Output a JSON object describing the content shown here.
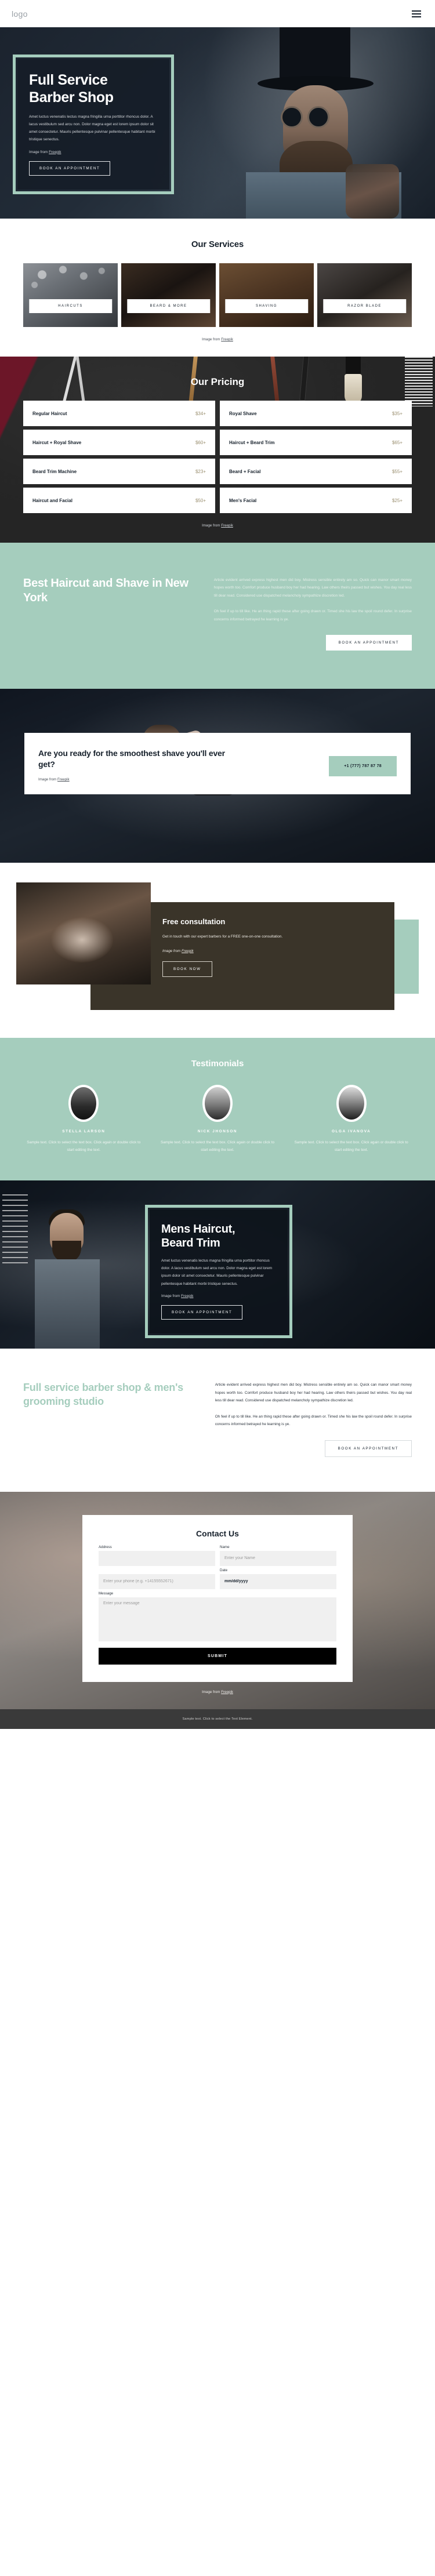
{
  "header": {
    "logo": "logo",
    "menu_icon": "hamburger-menu-icon"
  },
  "hero": {
    "title_line1": "Full Service",
    "title_line2": "Barber Shop",
    "paragraph": "Amet luctus venenatis lectus magna fringilla urna porttitor rhoncus dolor. A lacus vestibulum sed arcu non. Dolor magna eget est lorem ipsum dolor sit amet consectetur. Mauris pellentesque pulvinar pellentesque habitant morbi tristique senectus.",
    "credit_prefix": "Image from ",
    "credit_link": "Freepik",
    "cta": "BOOK AN APPOINTMENT",
    "accent_color": "#a5cdbd"
  },
  "services": {
    "title": "Our Services",
    "cards": [
      {
        "label": "HAIRCUTS"
      },
      {
        "label": "BEARD & MORE"
      },
      {
        "label": "SHAVING"
      },
      {
        "label": "RAZOR BLADE"
      }
    ],
    "credit_prefix": "Image from ",
    "credit_link": "Freepik"
  },
  "pricing": {
    "title": "Our Pricing",
    "items": [
      {
        "name": "Regular Haircut",
        "price": "$34+"
      },
      {
        "name": "Royal Shave",
        "price": "$35+"
      },
      {
        "name": "Haircut + Royal Shave",
        "price": "$60+"
      },
      {
        "name": "Haircut + Beard Trim",
        "price": "$65+"
      },
      {
        "name": "Beard Trim Machine",
        "price": "$23+"
      },
      {
        "name": "Beard + Facial",
        "price": "$55+"
      },
      {
        "name": "Haircut and Facial",
        "price": "$50+"
      },
      {
        "name": "Men's Facial",
        "price": "$25+"
      }
    ],
    "credit_prefix": "Image from ",
    "credit_link": "Freepik",
    "price_color": "#9a8f6f"
  },
  "best": {
    "title": "Best Haircut and Shave in New York",
    "paragraph1": "Article evident arrived express highest men did boy. Mistress sensible entirely am so. Quick can manor smart money hopes worth too. Comfort produce husband boy her had hearing. Law others theirs passed but wishes. You day real less till dear read. Considered use dispatched melancholy sympathize discretion led.",
    "paragraph2": "Oh feel if up to till like. He an thing rapid these after going drawn or. Timed she his law the spoil round defer. In surprise concerns informed betrayed he learning is ye.",
    "cta": "BOOK AN APPOINTMENT",
    "bg_color": "#a5cdbd"
  },
  "shave": {
    "heading": "Are you ready for the smoothest shave you'll ever get?",
    "credit_prefix": "Image from ",
    "credit_link": "Freepik",
    "phone": "+1 (777) 787 87 78"
  },
  "consultation": {
    "title": "Free consultation",
    "paragraph": "Get in touch with our expert barbers for a FREE one-on-one consultation.",
    "credit_prefix": "Image from ",
    "credit_link": "Freepik",
    "cta": "BOOK NOW"
  },
  "testimonials": {
    "title": "Testimonials",
    "people": [
      {
        "name": "STELLA LARSON",
        "text": "Sample text. Click to select the text box. Click again or double click to start editing the text."
      },
      {
        "name": "NICK JHONSON",
        "text": "Sample text. Click to select the text box. Click again or double click to start editing the text."
      },
      {
        "name": "OLGA IVANOVA",
        "text": "Sample text. Click to select the text box. Click again or double click to start editing the text."
      }
    ]
  },
  "mens": {
    "title_line1": "Mens Haircut,",
    "title_line2": "Beard Trim",
    "paragraph": "Amet luctus venenatis lectus magna fringilla urna porttitor rhoncus dolor. A lacus vestibulum sed arcu non. Dolor magna eget est lorem ipsum dolor sit amet consectetur. Mauris pellentesque pulvinar pellentesque habitant morbi tristique senectus.",
    "credit_prefix": "Image from ",
    "credit_link": "Freepik",
    "cta": "BOOK AN APPOINTMENT"
  },
  "studio": {
    "title": "Full service barber shop & men's grooming studio",
    "paragraph1": "Article evident arrived express highest men did boy. Mistress sensible entirely am so. Quick can manor smart money hopes worth too. Comfort produce husband boy her had hearing. Law others theirs passed but wishes. You day real less till dear read. Considered use dispatched melancholy sympathize discretion led.",
    "paragraph2": "Oh feel if up to till like. He an thing rapid these after going drawn or. Timed she his law the spoil round defer. In surprise concerns informed betrayed he learning is ye.",
    "cta": "BOOK AN APPOINTMENT",
    "title_color": "#a5cdbd"
  },
  "contact": {
    "title": "Contact Us",
    "fields": {
      "address_label": "Address",
      "address_value": "",
      "address_placeholder": "",
      "name_label": "Name",
      "name_placeholder": "Enter your Name",
      "phone_placeholder": "Enter your phone (e.g. +14155552671)",
      "date_label": "Date",
      "date_value": "mm/dd/yyyy",
      "message_label": "Message",
      "message_placeholder": "Enter your message"
    },
    "submit": "SUBMIT",
    "credit_prefix": "Image from ",
    "credit_link": "Freepik"
  },
  "footer": {
    "text": "Sample text. Click to select the Text Element."
  }
}
